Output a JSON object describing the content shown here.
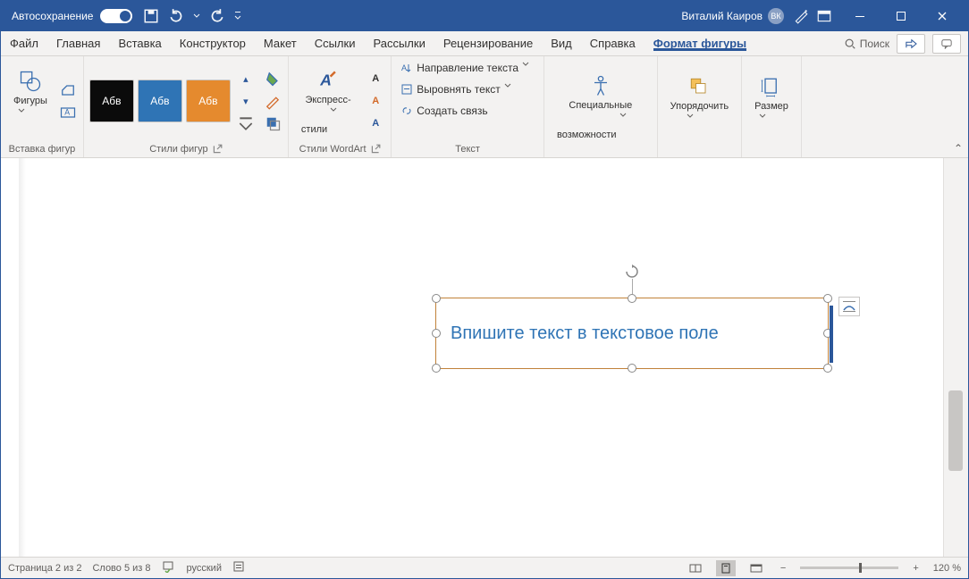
{
  "titlebar": {
    "autosave": "Автосохранение",
    "user_name": "Виталий Каиров",
    "user_initials": "ВК"
  },
  "tabs": {
    "file": "Файл",
    "home": "Главная",
    "insert": "Вставка",
    "construct": "Конструктор",
    "layout": "Макет",
    "refs": "Ссылки",
    "mail": "Рассылки",
    "review": "Рецензирование",
    "view": "Вид",
    "help": "Справка",
    "format": "Формат фигуры",
    "search": "Поиск"
  },
  "ribbon": {
    "shapes_btn": "Фигуры",
    "group_insert": "Вставка фигур",
    "group_styles": "Стили фигур",
    "group_wordart": "Стили WordArt",
    "express_btn_l1": "Экспресс-",
    "express_btn_l2": "стили",
    "group_text": "Текст",
    "text_direction": "Направление текста",
    "align_text": "Выровнять текст",
    "create_link": "Создать связь",
    "acc_l1": "Специальные",
    "acc_l2": "возможности",
    "arrange": "Упорядочить",
    "size": "Размер",
    "swatch": "Абв"
  },
  "document": {
    "textbox_content": "Впишите текст в текстовое поле"
  },
  "status": {
    "page": "Страница 2 из 2",
    "words": "Слово 5 из 8",
    "lang": "русский",
    "zoom": "120 %"
  }
}
